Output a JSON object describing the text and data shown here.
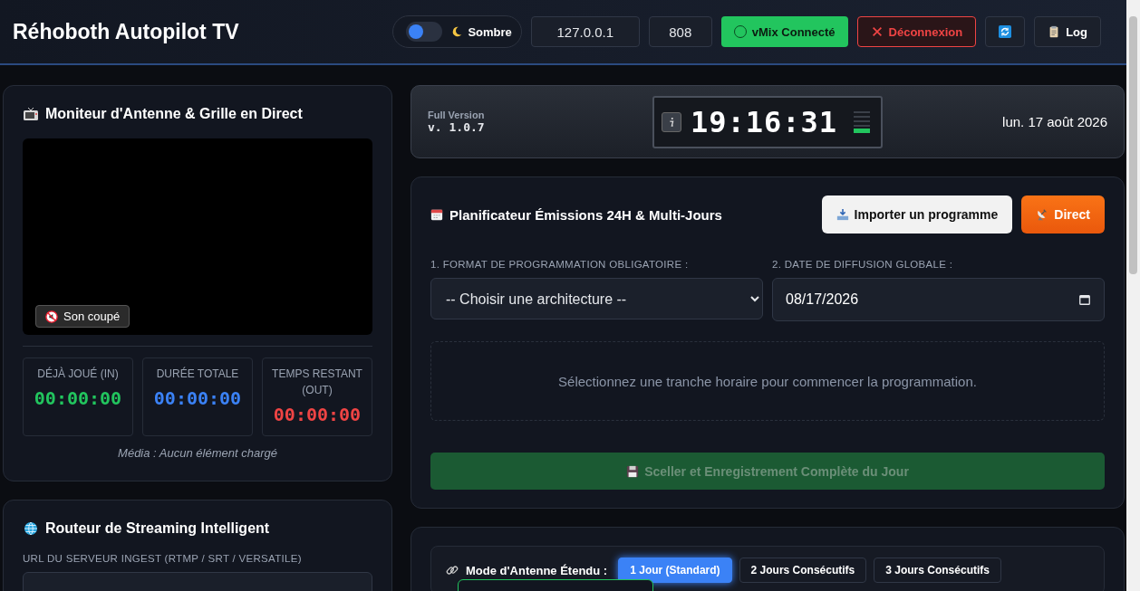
{
  "header": {
    "title": "Réhoboth Autopilot TV",
    "theme_toggle": {
      "label": "Sombre",
      "on": false
    },
    "host_field": {
      "value": "127.0.0.1"
    },
    "port_field": {
      "value": "808"
    },
    "buttons": [
      {
        "kind": "status",
        "label": "vMix Connecté",
        "color": "#22c55e"
      },
      {
        "kind": "danger",
        "label": "Déconnexion"
      },
      {
        "kind": "refresh"
      },
      {
        "kind": "log",
        "label": "Log"
      }
    ]
  },
  "monitor": {
    "title": "Moniteur d'Antenne & Grille en Direct",
    "mute_badge": "Son coupé",
    "timers": [
      {
        "label": "DÉJÀ JOUÉ (IN)",
        "value": "00:00:00",
        "color": "#22c55e"
      },
      {
        "label": "DURÉE TOTALE",
        "value": "00:00:00",
        "color": "#3b82f6"
      },
      {
        "label": "TEMPS RESTANT (OUT)",
        "value": "00:00:00",
        "color": "#ef4444"
      }
    ],
    "media_status": "Média : Aucun élément chargé"
  },
  "router": {
    "title": "Routeur de Streaming Intelligent",
    "url_label": "URL DU SERVEUR INGEST (RTMP / SRT / VERSATILE)"
  },
  "clock_bar": {
    "edition": "Full Version",
    "version": "v. 1.0.7",
    "time": "19:16:31",
    "meter": {
      "level": 0.2
    },
    "date": "lun. 17 août 2026"
  },
  "planner": {
    "title": "Planificateur Émissions 24H & Multi-Jours",
    "import_button": "Importer un programme",
    "live_button": "Direct",
    "format_label": "1. FORMAT DE PROGRAMMATION OBLIGATOIRE :",
    "format_select": "-- Choisir une architecture --",
    "date_label": "2. DATE DE DIFFUSION GLOBALE :",
    "date_field": "08/17/2026",
    "empty_message": "Sélectionnez une tranche horaire pour commencer la programmation.",
    "save_button": {
      "label": "Sceller et Enregistrement Complète du Jour",
      "disabled": true
    }
  },
  "antenna_mode": {
    "label": "Mode d'Antenne Étendu :",
    "options": [
      {
        "label": "1 Jour (Standard)",
        "selected": true
      },
      {
        "label": "2 Jours Consécutifs",
        "selected": false
      },
      {
        "label": "3 Jours Consécutifs",
        "selected": false
      }
    ]
  }
}
